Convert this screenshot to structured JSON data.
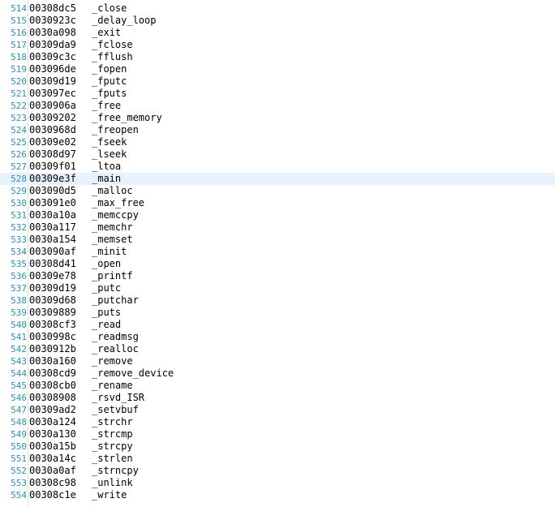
{
  "editor": {
    "current_line": 528,
    "lines": [
      {
        "n": "514",
        "addr": "00308dc5",
        "sym": "_close"
      },
      {
        "n": "515",
        "addr": "0030923c",
        "sym": "_delay_loop"
      },
      {
        "n": "516",
        "addr": "0030a098",
        "sym": "_exit"
      },
      {
        "n": "517",
        "addr": "00309da9",
        "sym": "_fclose"
      },
      {
        "n": "518",
        "addr": "00309c3c",
        "sym": "_fflush"
      },
      {
        "n": "519",
        "addr": "003096de",
        "sym": "_fopen"
      },
      {
        "n": "520",
        "addr": "00309d19",
        "sym": "_fputc"
      },
      {
        "n": "521",
        "addr": "003097ec",
        "sym": "_fputs"
      },
      {
        "n": "522",
        "addr": "0030906a",
        "sym": "_free"
      },
      {
        "n": "523",
        "addr": "00309202",
        "sym": "_free_memory"
      },
      {
        "n": "524",
        "addr": "0030968d",
        "sym": "_freopen"
      },
      {
        "n": "525",
        "addr": "00309e02",
        "sym": "_fseek"
      },
      {
        "n": "526",
        "addr": "00308d97",
        "sym": "_lseek"
      },
      {
        "n": "527",
        "addr": "00309f01",
        "sym": "_ltoa"
      },
      {
        "n": "528",
        "addr": "00309e3f",
        "sym": "_main"
      },
      {
        "n": "529",
        "addr": "003090d5",
        "sym": "_malloc"
      },
      {
        "n": "530",
        "addr": "003091e0",
        "sym": "_max_free"
      },
      {
        "n": "531",
        "addr": "0030a10a",
        "sym": "_memccpy"
      },
      {
        "n": "532",
        "addr": "0030a117",
        "sym": "_memchr"
      },
      {
        "n": "533",
        "addr": "0030a154",
        "sym": "_memset"
      },
      {
        "n": "534",
        "addr": "003090af",
        "sym": "_minit"
      },
      {
        "n": "535",
        "addr": "00308d41",
        "sym": "_open"
      },
      {
        "n": "536",
        "addr": "00309e78",
        "sym": "_printf"
      },
      {
        "n": "537",
        "addr": "00309d19",
        "sym": "_putc"
      },
      {
        "n": "538",
        "addr": "00309d68",
        "sym": "_putchar"
      },
      {
        "n": "539",
        "addr": "00309889",
        "sym": "_puts"
      },
      {
        "n": "540",
        "addr": "00308cf3",
        "sym": "_read"
      },
      {
        "n": "541",
        "addr": "0030998c",
        "sym": "_readmsg"
      },
      {
        "n": "542",
        "addr": "0030912b",
        "sym": "_realloc"
      },
      {
        "n": "543",
        "addr": "0030a160",
        "sym": "_remove"
      },
      {
        "n": "544",
        "addr": "00308cd9",
        "sym": "_remove_device"
      },
      {
        "n": "545",
        "addr": "00308cb0",
        "sym": "_rename"
      },
      {
        "n": "546",
        "addr": "00308908",
        "sym": "_rsvd_ISR"
      },
      {
        "n": "547",
        "addr": "00309ad2",
        "sym": "_setvbuf"
      },
      {
        "n": "548",
        "addr": "0030a124",
        "sym": "_strchr"
      },
      {
        "n": "549",
        "addr": "0030a130",
        "sym": "_strcmp"
      },
      {
        "n": "550",
        "addr": "0030a15b",
        "sym": "_strcpy"
      },
      {
        "n": "551",
        "addr": "0030a14c",
        "sym": "_strlen"
      },
      {
        "n": "552",
        "addr": "0030a0af",
        "sym": "_strncpy"
      },
      {
        "n": "553",
        "addr": "00308c98",
        "sym": "_unlink"
      },
      {
        "n": "554",
        "addr": "00308c1e",
        "sym": "_write"
      }
    ]
  },
  "colors": {
    "line_number": "#2b91af",
    "current_line_highlight": "#e8f2fe",
    "text": "#000000",
    "background": "#ffffff"
  }
}
